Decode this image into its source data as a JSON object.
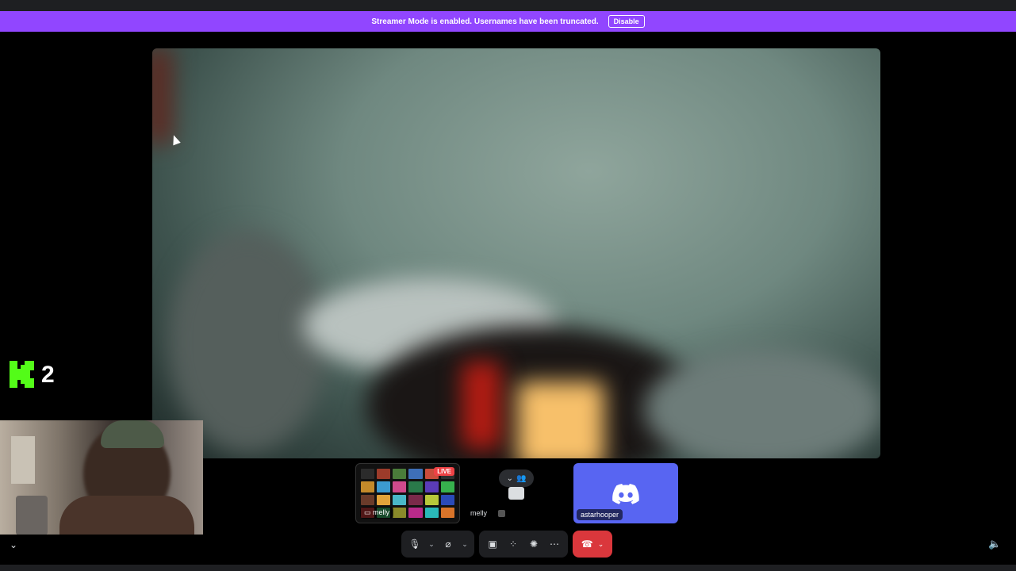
{
  "banner": {
    "message": "Streamer Mode is enabled. Usernames have been truncated.",
    "disable_label": "Disable",
    "color": "#9146ff"
  },
  "overlay": {
    "logo_number": "2",
    "logo_color": "#53fc18"
  },
  "tiles": {
    "stream": {
      "label": "melly",
      "live_badge": "LIVE"
    },
    "melly": {
      "label": "melly"
    },
    "discord": {
      "label": "astarhooper",
      "color": "#5865f2"
    }
  },
  "controls": {
    "icons": [
      "microphone-icon",
      "camera-off-icon",
      "screen-share-icon",
      "activities-icon",
      "soundboard-icon",
      "more-icon",
      "hangup-icon"
    ],
    "hangup_color": "#da373c"
  }
}
